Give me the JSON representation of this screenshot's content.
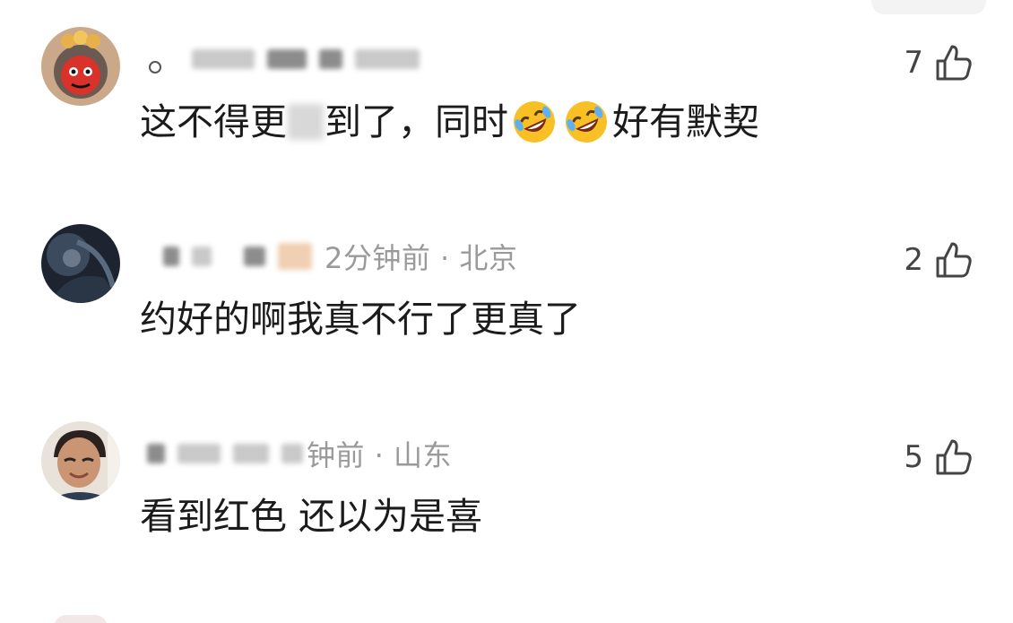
{
  "comments": [
    {
      "separator": "。",
      "text_before": "这不得更",
      "text_after": "到了，同时",
      "emojis": [
        "rolling-laughing-emoji",
        "rolling-laughing-emoji"
      ],
      "text_end": "好有默契",
      "likes": "7"
    },
    {
      "meta": "2分钟前 · 北京",
      "text": "约好的啊我真不行了更真了",
      "likes": "2"
    },
    {
      "meta": "钟前 · 山东",
      "text": "看到红色 还以为是喜",
      "likes": "5"
    }
  ],
  "icons": {
    "like": "thumbs-up-icon"
  },
  "colors": {
    "meta": "#9a9a9a",
    "body": "#1b1b1b",
    "accent_red": "#e6352b"
  }
}
